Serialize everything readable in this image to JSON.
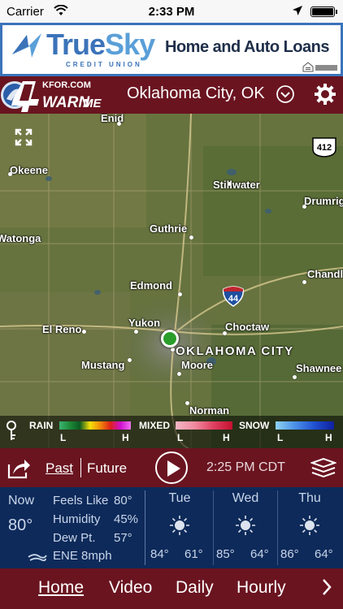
{
  "status": {
    "carrier": "Carrier",
    "time": "2:33 PM"
  },
  "ad": {
    "brand_true": "True",
    "brand_sky": "Sky",
    "brand_sub": "CREDIT UNION",
    "tagline": "Home and Auto Loans",
    "housing_label": "EQUAL HOUSING"
  },
  "header": {
    "logo_station": "KFOR.COM",
    "logo_number": "4",
    "logo_warn": "WARN",
    "logo_me": "ME",
    "location": "Oklahoma City, OK"
  },
  "map": {
    "places": [
      {
        "name": "Enid",
        "big": false
      },
      {
        "name": "Okeene",
        "big": false
      },
      {
        "name": "Stillwater",
        "big": false
      },
      {
        "name": "Drumright",
        "big": false
      },
      {
        "name": "Watonga",
        "big": false
      },
      {
        "name": "Guthrie",
        "big": false
      },
      {
        "name": "Chandler",
        "big": false
      },
      {
        "name": "Edmond",
        "big": false
      },
      {
        "name": "El Reno",
        "big": false
      },
      {
        "name": "Yukon",
        "big": false
      },
      {
        "name": "Choctaw",
        "big": false
      },
      {
        "name": "OKLAHOMA CITY",
        "big": true
      },
      {
        "name": "Mustang",
        "big": false
      },
      {
        "name": "Moore",
        "big": false
      },
      {
        "name": "Shawnee",
        "big": false
      },
      {
        "name": "Norman",
        "big": false
      }
    ],
    "highway_412": "412",
    "highway_44": "44"
  },
  "legend": {
    "rain": "RAIN",
    "mixed": "MIXED",
    "snow": "SNOW",
    "low": "L",
    "high": "H"
  },
  "playback": {
    "past": "Past",
    "future": "Future",
    "time": "2:25 PM CDT"
  },
  "current": {
    "now_label": "Now",
    "temp": "80°",
    "feels_like_label": "Feels Like",
    "feels_like": "80°",
    "humidity_label": "Humidity",
    "humidity": "45%",
    "dew_label": "Dew Pt.",
    "dew": "57°",
    "wind": "ENE 8mph"
  },
  "forecast": [
    {
      "day": "Tue",
      "hi": "84°",
      "lo": "61°",
      "icon": "sun-icon"
    },
    {
      "day": "Wed",
      "hi": "85°",
      "lo": "64°",
      "icon": "sun-icon"
    },
    {
      "day": "Thu",
      "hi": "86°",
      "lo": "64°",
      "icon": "sun-icon"
    }
  ],
  "nav": {
    "tabs": [
      "Home",
      "Video",
      "Daily",
      "Hourly"
    ]
  },
  "colors": {
    "header": "#6a1420",
    "panel": "#0e2a5a",
    "ad_border": "#3b73b9",
    "location_dot": "#2a9d2a"
  }
}
